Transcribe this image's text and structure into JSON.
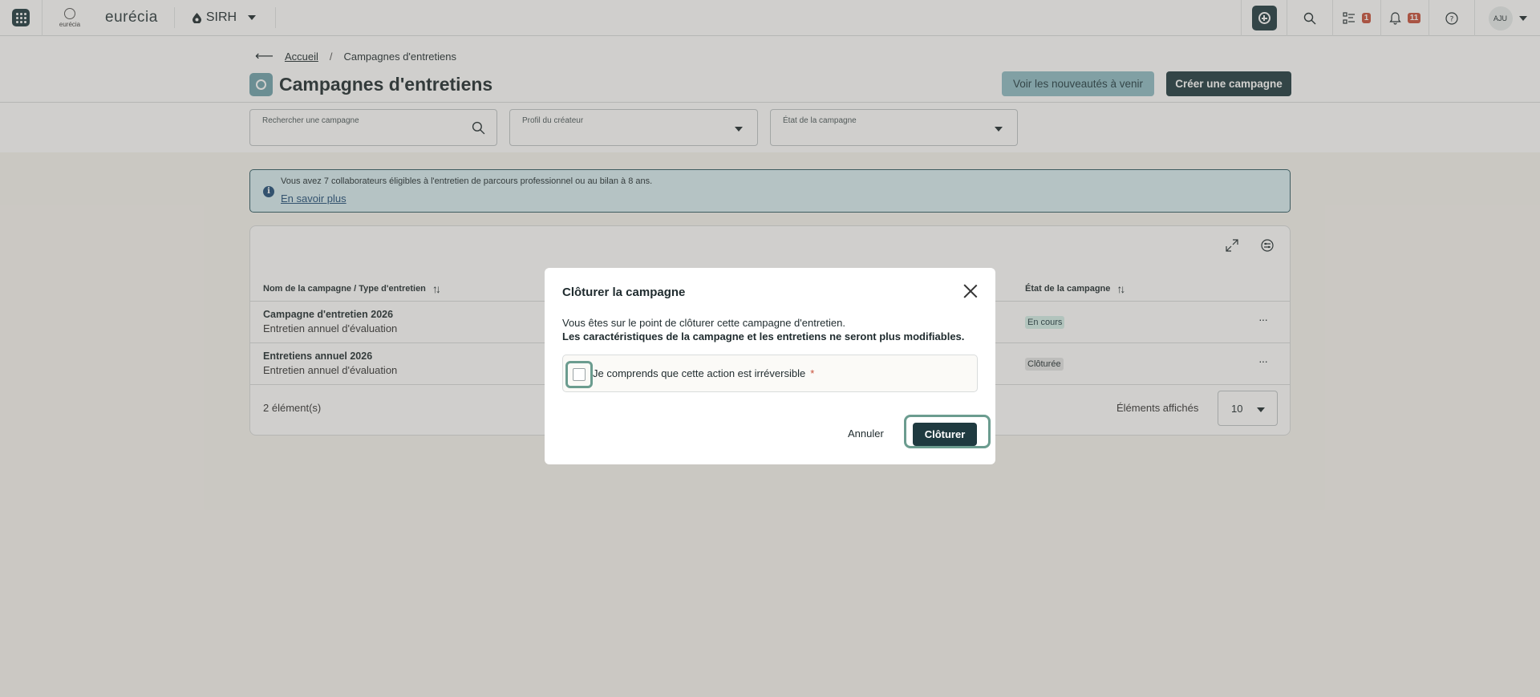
{
  "topbar": {
    "logo_small": "eurécia",
    "logo_word": "eurécia",
    "module": "SIRH",
    "tasks_badge": "1",
    "notifications_badge": "11",
    "user_initials": "AJU"
  },
  "breadcrumb": {
    "home": "Accueil",
    "current": "Campagnes d'entretiens"
  },
  "page": {
    "title": "Campagnes d'entretiens",
    "btn_news": "Voir les nouveautés à venir",
    "btn_create": "Créer une campagne"
  },
  "filters": {
    "search_label": "Rechercher une campagne",
    "creator_label": "Profil du créateur",
    "state_label": "État de la campagne"
  },
  "info": {
    "text": "Vous avez 7 collaborateurs éligibles à l'entretien de parcours professionnel ou au bilan à 8 ans.",
    "link": "En savoir plus"
  },
  "table": {
    "col_name": "Nom de la campagne / Type d'entretien",
    "col_state": "État de la campagne",
    "rows": [
      {
        "name": "Campagne d'entretien 2026",
        "type": "Entretien annuel d'évaluation",
        "state": "En cours"
      },
      {
        "name": "Entretiens annuel 2026",
        "type": "Entretien annuel d'évaluation",
        "state": "Clôturée"
      }
    ],
    "count": "2 élément(s)",
    "per_page_label": "Éléments affichés",
    "per_page_value": "10"
  },
  "modal": {
    "title": "Clôturer la campagne",
    "line1": "Vous êtes sur le point de clôturer cette campagne d'entretien.",
    "line2": "Les caractéristiques de la campagne et les entretiens ne seront plus modifiables.",
    "checkbox_label": "Je comprends que cette action est irréversible",
    "required_mark": "*",
    "cancel": "Annuler",
    "confirm": "Clôturer"
  },
  "colors": {
    "primary": "#1f3a40",
    "accent_light": "#8fbcc4",
    "badge": "#c8503a",
    "focus_ring": "#6b9c8f"
  }
}
